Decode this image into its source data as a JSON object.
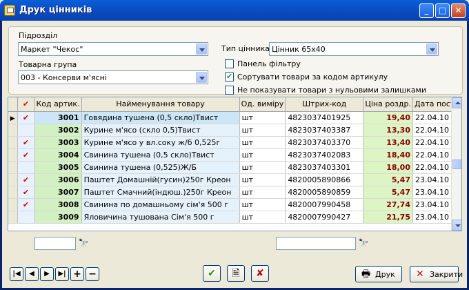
{
  "window": {
    "title": "Друк цінників"
  },
  "filters": {
    "subdivision_label": "Підрозділ",
    "subdivision_value": "Маркет \"Чекос\"",
    "group_label": "Товарна група",
    "group_value": "003 - Консерви м'ясні",
    "tag_type_label": "Тип цінника",
    "tag_type_value": "Цінник 65х40",
    "options": [
      {
        "label": "Панель фільтру",
        "checked": false
      },
      {
        "label": "Сортувати товари за кодом артикулу",
        "checked": true
      },
      {
        "label": "Не показувати товари з нульовими залишками",
        "checked": false
      }
    ]
  },
  "grid": {
    "columns": {
      "mark": "✔",
      "code": "Код артик.",
      "name": "Найменування товару",
      "unit": "Од. виміру",
      "barcode": "Штрих-код",
      "price": "Ціна роздр.",
      "date": "Дата пост."
    },
    "rows": [
      {
        "mark": "✔",
        "code": "3001",
        "name": "Говядина тушена (0,5 скло)Твист",
        "unit": "шт",
        "barcode": "4823037401925",
        "price": "19,40",
        "date": "22.04.10"
      },
      {
        "mark": "",
        "code": "3002",
        "name": "Курине м'ясо (скло 0,5)Твист",
        "unit": "шт",
        "barcode": "4823037403387",
        "price": "13,30",
        "date": "22.04.10"
      },
      {
        "mark": "✔",
        "code": "3003",
        "name": "Курине м'ясо у вл.соку ж/б 0,525г",
        "unit": "шт",
        "barcode": "4823037403370",
        "price": "13,40",
        "date": "22.04.10"
      },
      {
        "mark": "✔",
        "code": "3004",
        "name": "Свинина тушена (0,5 скло)Твист",
        "unit": "шт",
        "barcode": "4823037402083",
        "price": "18,40",
        "date": "22.04.10"
      },
      {
        "mark": "",
        "code": "3005",
        "name": "Свинина тушена (0,525)Ж/Б",
        "unit": "шт",
        "barcode": "4823037403301",
        "price": "18,00",
        "date": "22.04.10"
      },
      {
        "mark": "✔",
        "code": "3006",
        "name": "Паштет Домашній(гусин)250г Креон",
        "unit": "шт",
        "barcode": "4820005890866",
        "price": "5,47",
        "date": "23.04.10"
      },
      {
        "mark": "✔",
        "code": "3007",
        "name": "Паштет Смачний(індюш.)250г Креон",
        "unit": "шт",
        "barcode": "4820005890859",
        "price": "5,47",
        "date": "23.04.10"
      },
      {
        "mark": "✔",
        "code": "3008",
        "name": "Свинина по домашньому сім'я 500 г",
        "unit": "шт",
        "barcode": "4820007990458",
        "price": "27,74",
        "date": "23.04.10"
      },
      {
        "mark": "",
        "code": "3009",
        "name": "Яловичина тушована Сім'я 500 г",
        "unit": "шт",
        "barcode": "4820007990427",
        "price": "21,75",
        "date": "23.04.10"
      }
    ]
  },
  "search": {
    "code_value": "",
    "barcode_value": ""
  },
  "buttons": {
    "print": "Друк",
    "close": "Закрити"
  },
  "icons": {
    "nav_first": "first-record-icon",
    "nav_prev": "prev-record-icon",
    "nav_next": "next-record-icon",
    "nav_last": "last-record-icon",
    "nav_add": "add-record-icon",
    "nav_delete": "delete-record-icon",
    "select_all": "check-icon",
    "report": "report-icon",
    "clear": "uncheck-icon",
    "search": "binoculars-icon",
    "print": "printer-icon",
    "close": "close-x-icon"
  }
}
